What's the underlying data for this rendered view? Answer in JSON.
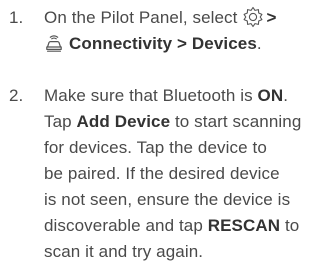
{
  "steps": [
    {
      "number": "1.",
      "line1_prefix": "On the Pilot Panel, select",
      "line1_suffix": ">",
      "line2_part1": "Connectivity",
      "line2_sep": ">",
      "line2_part2": "Devices",
      "line2_end": ".",
      "icons": [
        "pilot-panel-hub-icon",
        "car-connectivity-icon"
      ]
    },
    {
      "number": "2.",
      "t1": "Make sure that Bluetooth is",
      "t1b": "ON",
      "t1e": ".",
      "t2": "Tap",
      "t2b": "Add Device",
      "t2e": "to start scanning",
      "t3": "for devices. Tap the device to",
      "t4": "be paired. If the desired device",
      "t5": "is not seen, ensure the device is",
      "t6": "discoverable and tap",
      "t6b": "RESCAN",
      "t6e": "to",
      "t7": "scan it and try again."
    }
  ]
}
